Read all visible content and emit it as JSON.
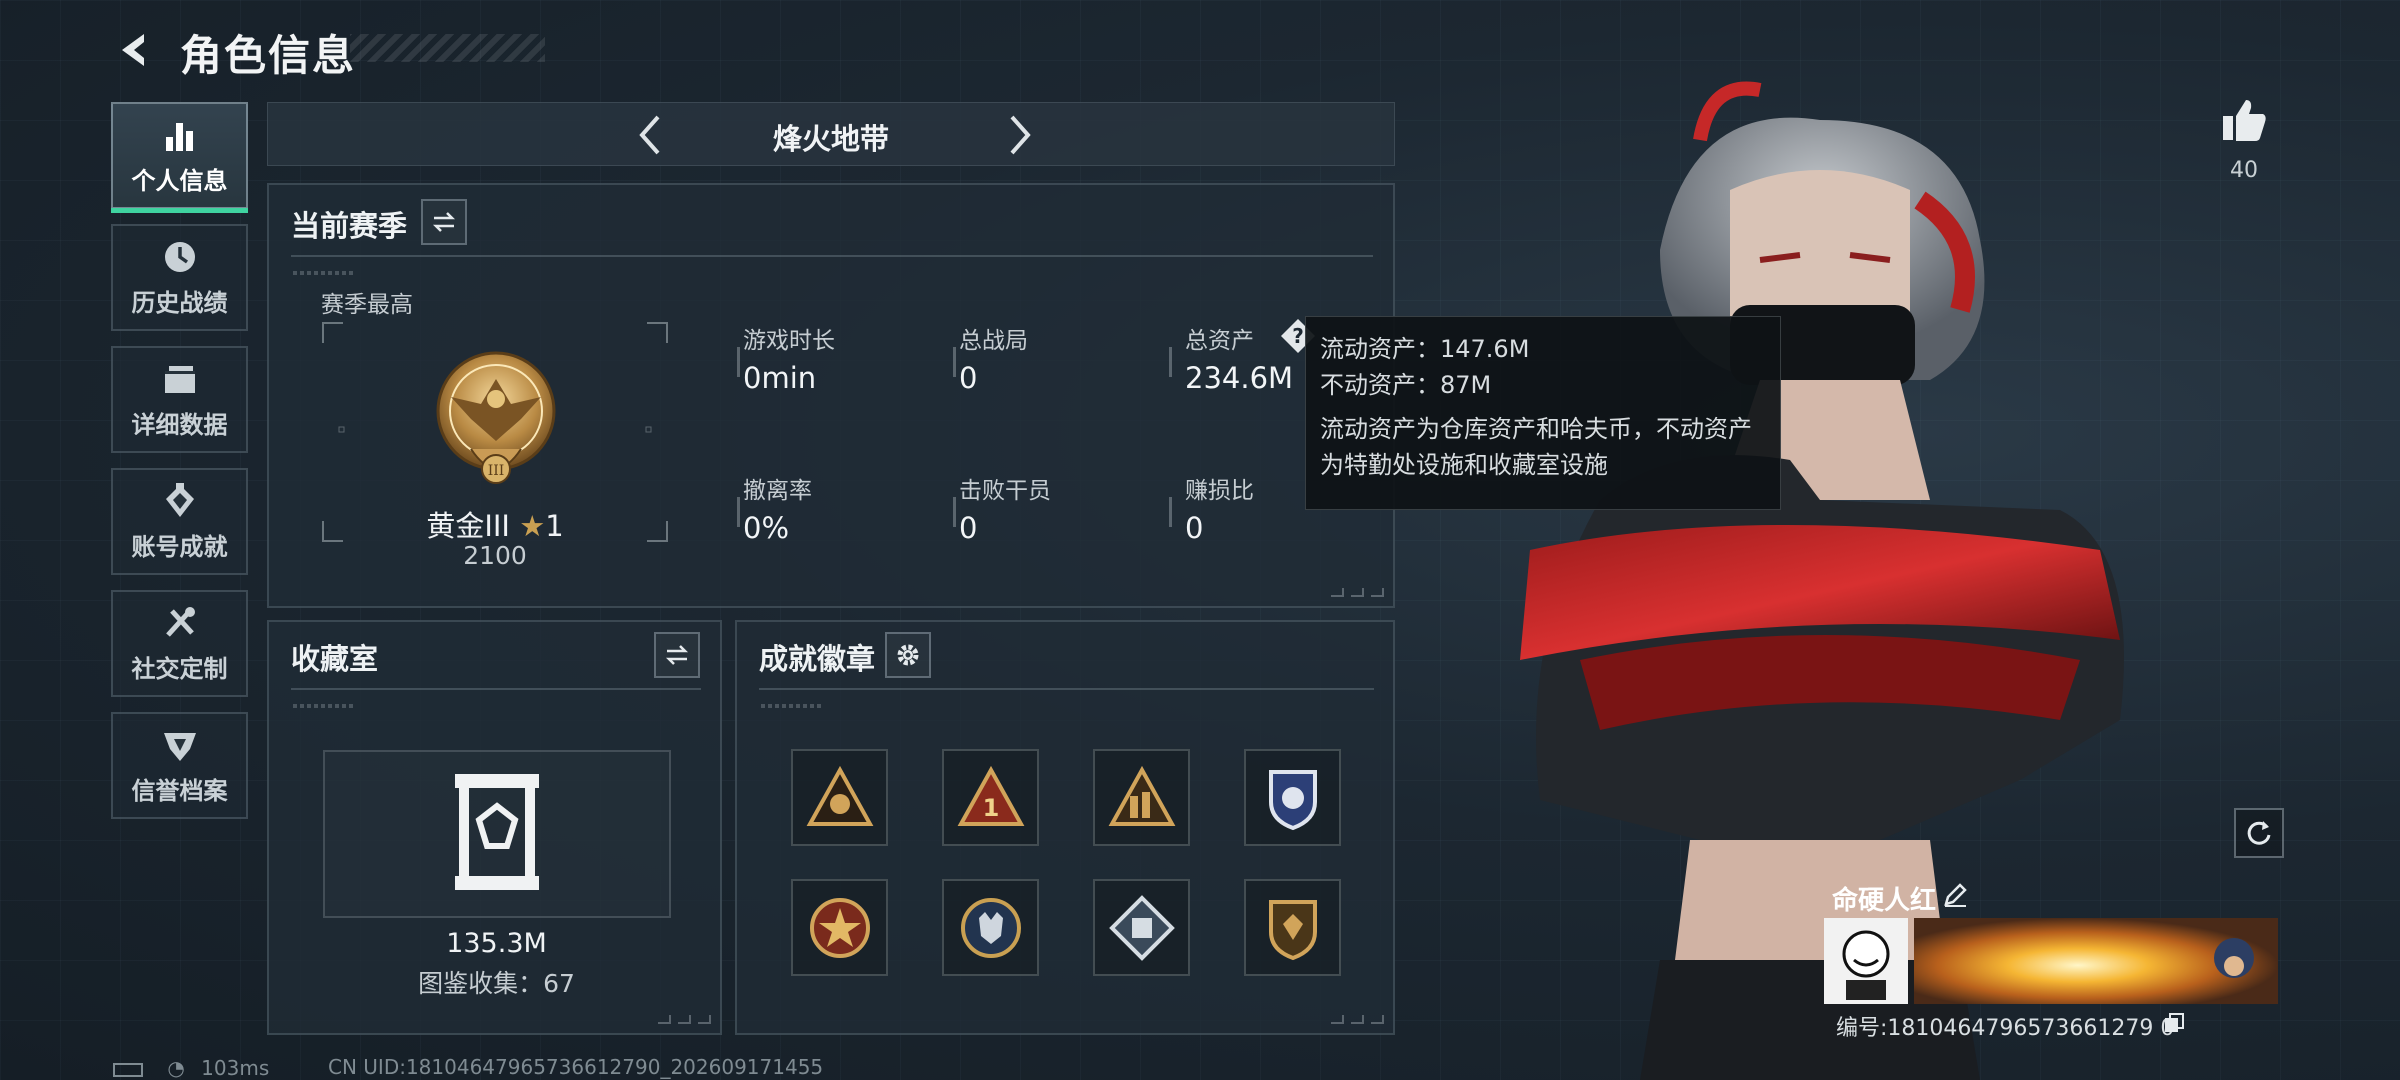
{
  "header": {
    "title": "角色信息",
    "back_icon": "back-arrow-icon"
  },
  "sidebar": {
    "items": [
      {
        "label": "个人信息",
        "icon": "bar-chart-icon",
        "active": true
      },
      {
        "label": "历史战绩",
        "icon": "clock-icon",
        "active": false
      },
      {
        "label": "详细数据",
        "icon": "folder-icon",
        "active": false
      },
      {
        "label": "账号成就",
        "icon": "achievement-icon",
        "active": false
      },
      {
        "label": "社交定制",
        "icon": "tools-icon",
        "active": false
      },
      {
        "label": "信誉档案",
        "icon": "shield-icon",
        "active": false
      }
    ]
  },
  "mode": {
    "title": "烽火地带"
  },
  "season": {
    "title": "当前赛季",
    "best_label": "赛季最高",
    "rank_name": "黄金III",
    "rank_stars": "1",
    "rank_score": "2100",
    "stats": [
      {
        "label": "游戏时长",
        "value": "0min"
      },
      {
        "label": "总战局",
        "value": "0"
      },
      {
        "label": "总资产",
        "value": "234.6M"
      },
      {
        "label": "撤离率",
        "value": "0%"
      },
      {
        "label": "击败干员",
        "value": "0"
      },
      {
        "label": "赚损比",
        "value": "0"
      }
    ]
  },
  "tooltip": {
    "line1": "流动资产：147.6M",
    "line2": "不动资产：87M",
    "line3": "流动资产为仓库资产和哈夫币，不动资产",
    "line4": "为特勤处设施和收藏室设施"
  },
  "collection": {
    "title": "收藏室",
    "value": "135.3M",
    "catalog": "图鉴收集：67"
  },
  "badges": {
    "title": "成就徽章",
    "items": [
      "triangle-emblem-icon",
      "triangle-one-icon",
      "triangle-squad-icon",
      "police-badge-icon",
      "star-medal-icon",
      "wolf-medal-icon",
      "diamond-fist-icon",
      "shield-crest-icon"
    ]
  },
  "profile": {
    "likes": "40",
    "name": "命硬人红",
    "id": "编号:1810464796573661279 0"
  },
  "statusbar": {
    "ping": "103ms",
    "uid": "CN UID:18104647965736612790_202609171455"
  },
  "colors": {
    "accent": "#3fd3a0",
    "gold": "#c9a052",
    "panel": "#202c36"
  }
}
